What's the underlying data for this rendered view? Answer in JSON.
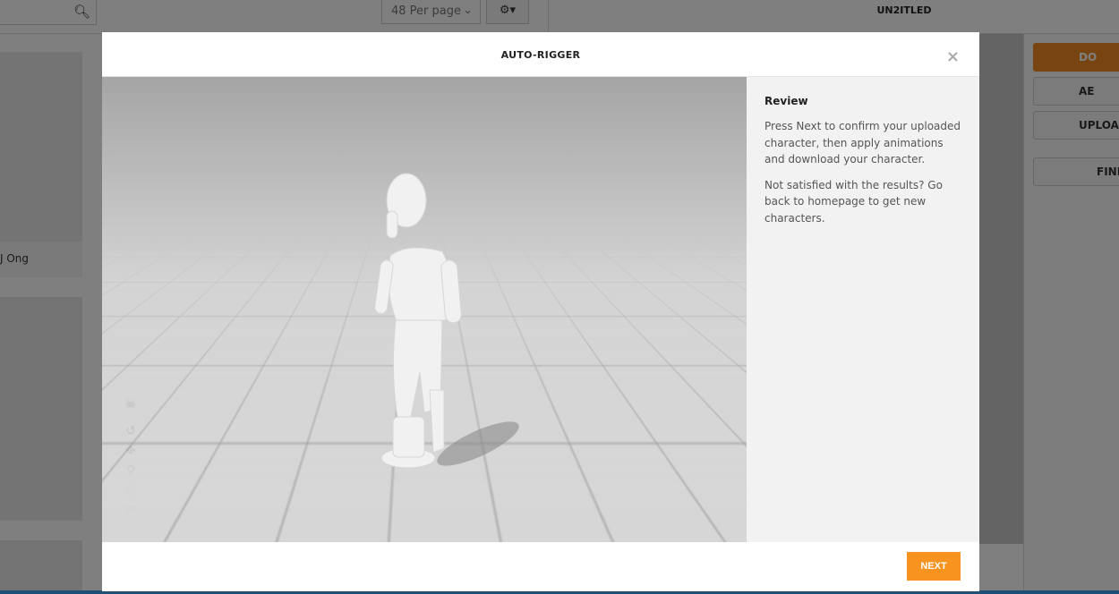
{
  "background": {
    "per_page": "48 Per page",
    "project_title": "UN2ITLED",
    "cards": [
      {
        "name": "J Ong"
      }
    ],
    "right_buttons": [
      "DO",
      "AE",
      "UPLOA",
      "FIND"
    ]
  },
  "modal": {
    "title": "AUTO-RIGGER",
    "close_icon": "×",
    "review_heading": "Review",
    "paragraph1": "Press Next to confirm your uploaded character, then apply animations and download your character.",
    "paragraph2": "Not satisfied with the results? Go back to homepage to get new characters.",
    "next_label": "NEXT",
    "tools": [
      "skull-icon",
      "reset-icon",
      "move-icon",
      "zoom-icon",
      "power-icon",
      "camera-icon"
    ]
  },
  "colors": {
    "accent": "#f7931e"
  }
}
